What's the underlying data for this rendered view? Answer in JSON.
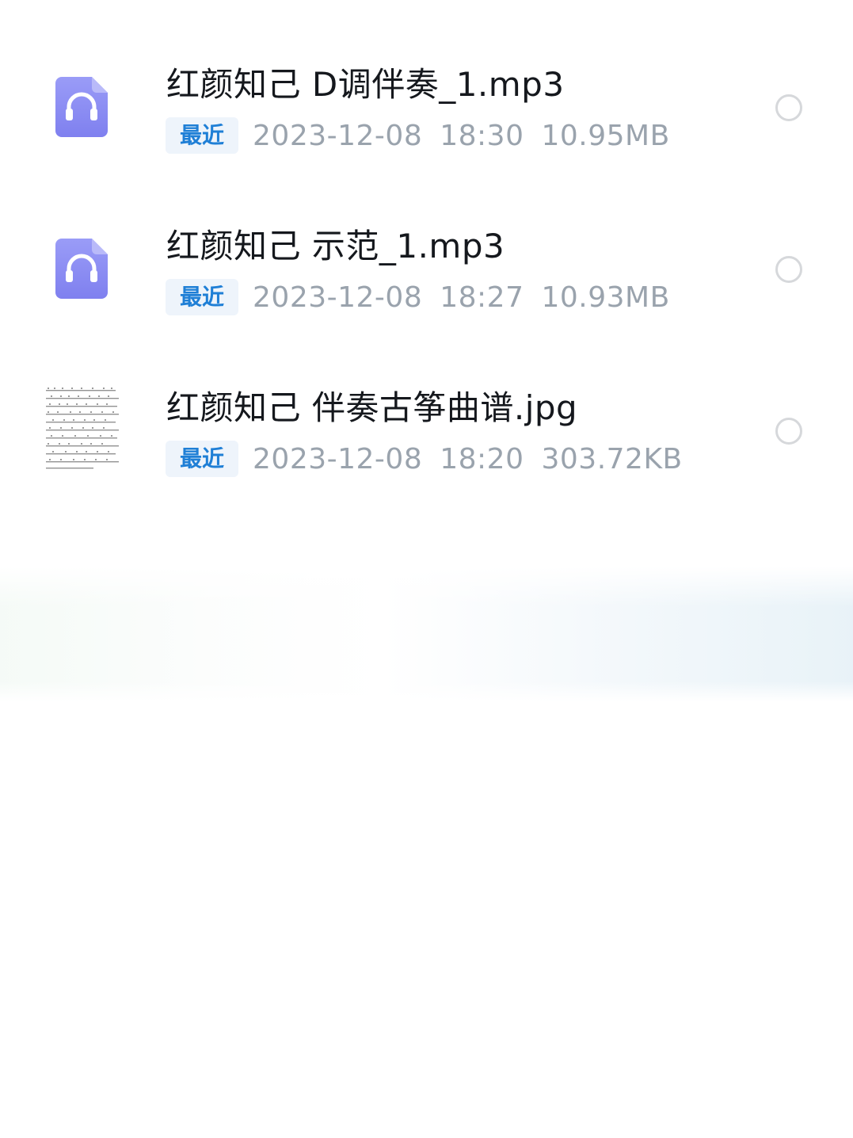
{
  "files": [
    {
      "name": "红颜知己 D调伴奏_1.mp3",
      "tag": "最近",
      "date": "2023-12-08",
      "time": "18:30",
      "size": "10.95MB",
      "icon": "audio-file-icon"
    },
    {
      "name": "红颜知己 示范_1.mp3",
      "tag": "最近",
      "date": "2023-12-08",
      "time": "18:27",
      "size": "10.93MB",
      "icon": "audio-file-icon"
    },
    {
      "name": "红颜知己 伴奏古筝曲谱.jpg",
      "tag": "最近",
      "date": "2023-12-08",
      "time": "18:20",
      "size": "303.72KB",
      "icon": "image-thumbnail"
    }
  ],
  "colors": {
    "audio_icon": "#8b8cf5",
    "tag_text": "#1f7fd6",
    "tag_bg": "#eef4fb",
    "meta_text": "#9aa3ad",
    "title_text": "#15181d"
  }
}
